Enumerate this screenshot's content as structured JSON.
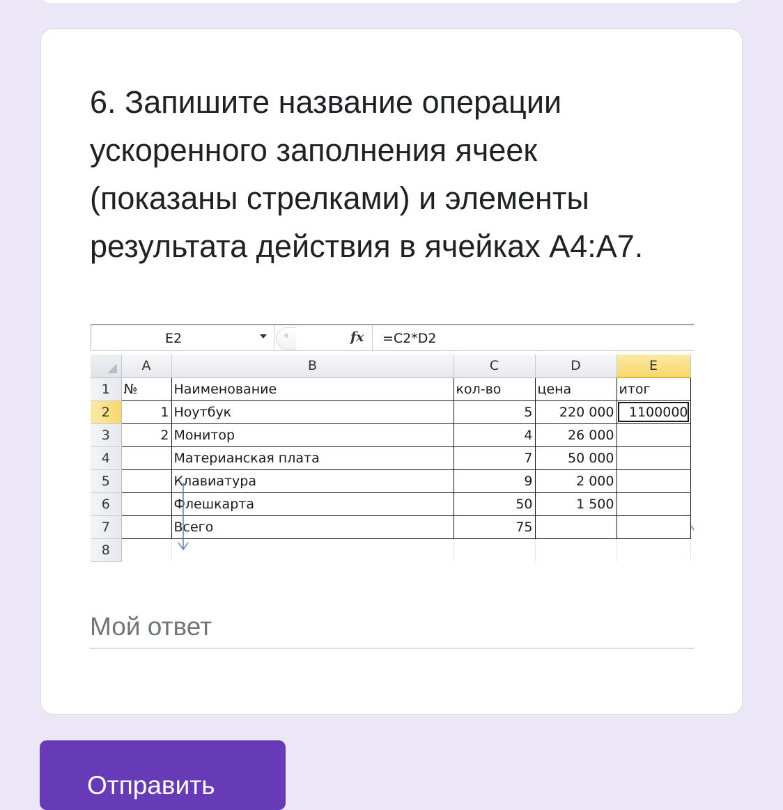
{
  "question": {
    "text": "6. Запишите название операции ускоренного заполнения ячеек (показаны стрелками) и элементы результата действия в ячейках А4:А7."
  },
  "spreadsheet": {
    "name_box": "E2",
    "fx_label": "fx",
    "formula": "=C2*D2",
    "column_headers": [
      "A",
      "B",
      "C",
      "D",
      "E"
    ],
    "row_headers": [
      "1",
      "2",
      "3",
      "4",
      "5",
      "6",
      "7",
      "8"
    ],
    "rows": [
      [
        "№",
        "Наименование",
        "кол-во",
        "цена",
        "итог"
      ],
      [
        "1",
        "Ноутбук",
        "5",
        "220 000",
        "1100000"
      ],
      [
        "2",
        "Монитор",
        "4",
        "26 000",
        ""
      ],
      [
        "",
        "Материанская плата",
        "7",
        "50 000",
        ""
      ],
      [
        "",
        "Клавиатура",
        "9",
        "2 000",
        ""
      ],
      [
        "",
        "Флешкарта",
        "50",
        "1 500",
        ""
      ],
      [
        "",
        "Всего",
        "75",
        "",
        ""
      ]
    ],
    "active_cell": "E2",
    "header_highlight_color": "#f7d86b"
  },
  "answer": {
    "placeholder": "Мой ответ",
    "value": ""
  },
  "submit": {
    "label": "Отправить",
    "color": "#673ab7"
  },
  "colors": {
    "background": "#ece7f6",
    "card": "#ffffff",
    "text": "#202124"
  }
}
